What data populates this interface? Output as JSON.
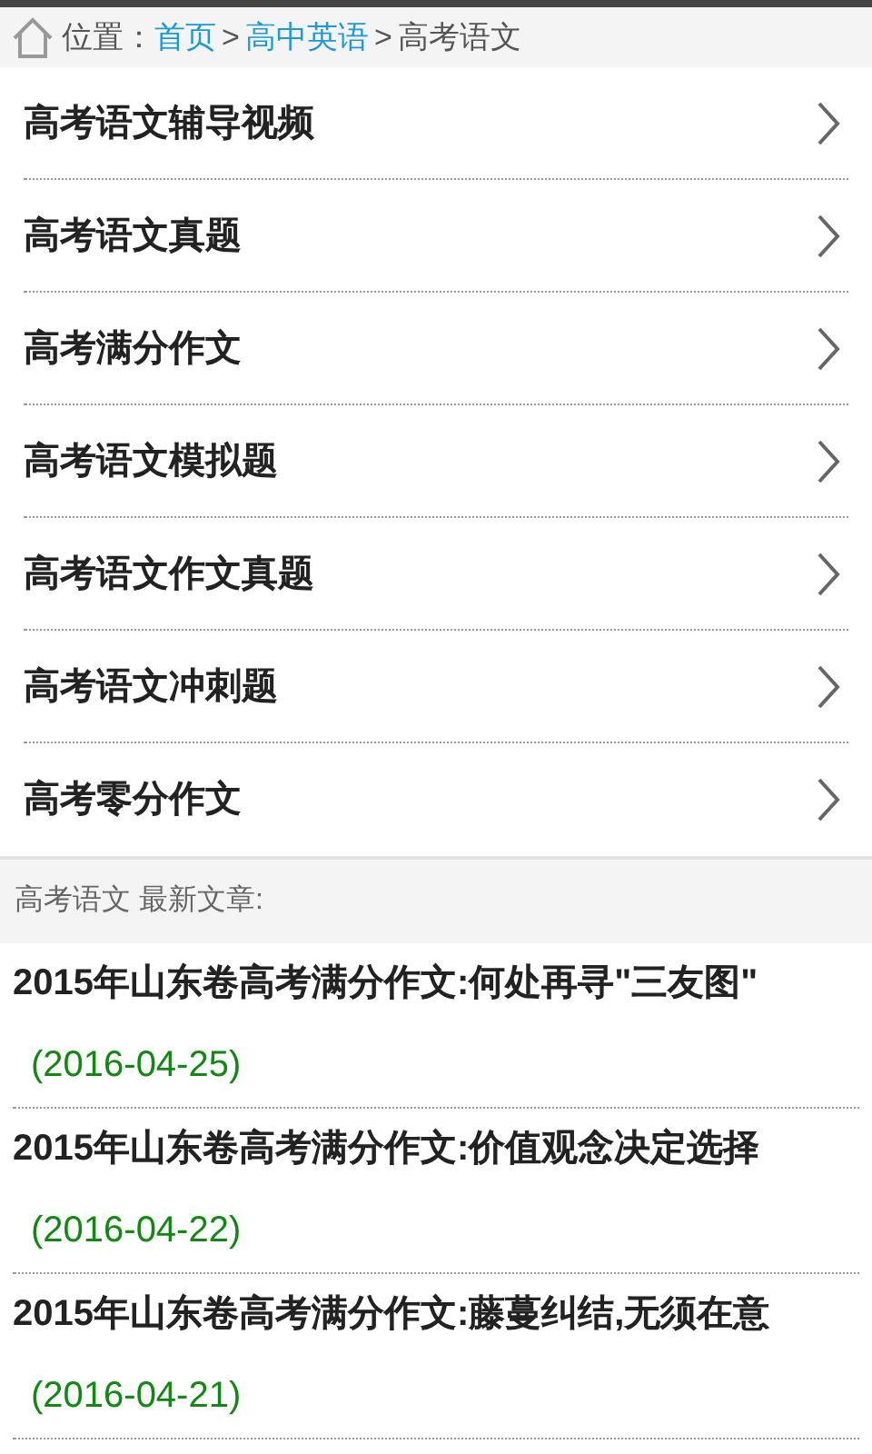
{
  "breadcrumb": {
    "label": "位置：",
    "items": [
      {
        "kind": "link",
        "text": "首页"
      },
      {
        "kind": "separator",
        "text": ">"
      },
      {
        "kind": "link",
        "text": "高中英语"
      },
      {
        "kind": "separator",
        "text": ">"
      },
      {
        "kind": "current",
        "text": "高考语文"
      }
    ]
  },
  "menu": [
    {
      "label": "高考语文辅导视频"
    },
    {
      "label": "高考语文真题"
    },
    {
      "label": "高考满分作文"
    },
    {
      "label": "高考语文模拟题"
    },
    {
      "label": "高考语文作文真题"
    },
    {
      "label": "高考语文冲刺题"
    },
    {
      "label": "高考零分作文"
    }
  ],
  "latest": {
    "title": "高考语文 最新文章:",
    "articles": [
      {
        "title": "2015年山东卷高考满分作文:何处再寻\"三友图\"",
        "date": "(2016-04-25)"
      },
      {
        "title": "2015年山东卷高考满分作文:价值观念决定选择",
        "date": "(2016-04-22)"
      },
      {
        "title": "2015年山东卷高考满分作文:藤蔓纠结,无须在意",
        "date": "(2016-04-21)"
      }
    ]
  }
}
